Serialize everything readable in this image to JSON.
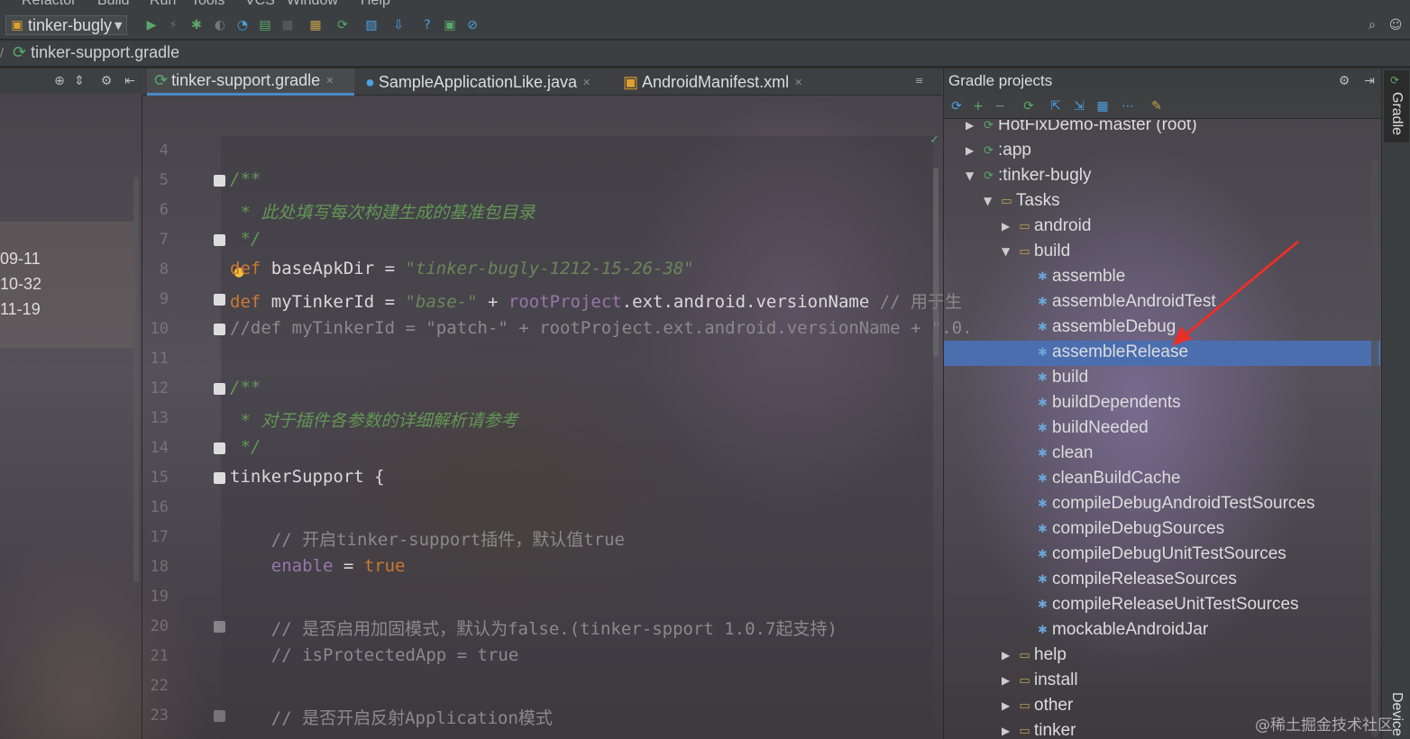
{
  "menu": {
    "items": [
      "Refactor",
      "Build",
      "Run",
      "Tools",
      "VCS",
      "Window",
      "Help"
    ]
  },
  "toolbar": {
    "run_config": "tinker-bugly"
  },
  "breadcrumb": {
    "file": "tinker-support.gradle"
  },
  "left_panel": {
    "items": [
      "09-11",
      "10-32",
      "11-19"
    ]
  },
  "editor": {
    "tabs": [
      {
        "label": "tinker-support.gradle",
        "active": true
      },
      {
        "label": "SampleApplicationLike.java",
        "active": false
      },
      {
        "label": "AndroidManifest.xml",
        "active": false
      }
    ],
    "line_numbers": [
      "4",
      "5",
      "6",
      "7",
      "8",
      "9",
      "10",
      "11",
      "12",
      "13",
      "14",
      "15",
      "16",
      "17",
      "18",
      "19",
      "20",
      "21",
      "22",
      "23"
    ],
    "code": {
      "l5": "/**",
      "l6": " * 此处填写每次构建生成的基准包目录",
      "l7": " */",
      "l8_kw": "def",
      "l8_var": " baseApkDir = ",
      "l8_str": "\"tinker-bugly-1212-15-26-38\"",
      "l9_kw": "def",
      "l9_var": " myTinkerId = ",
      "l9_str": "\"base-\"",
      "l9_plus": " + ",
      "l9_field": "rootProject",
      "l9_rest": ".ext.android.versionName",
      "l9_comment": " // 用于生",
      "l10": "//def myTinkerId = \"patch-\" + rootProject.ext.android.versionName + \".0.",
      "l12": "/**",
      "l13": " * 对于插件各参数的详细解析请参考",
      "l14": " */",
      "l15": "tinkerSupport {",
      "l17": "    // 开启tinker-support插件，默认值true",
      "l18_field": "    enable",
      "l18_eq": " = ",
      "l18_val": "true",
      "l20": "    // 是否启用加固模式，默认为false.(tinker-spport 1.0.7起支持)",
      "l21": "    // isProtectedApp = true",
      "l23": "    // 是否开启反射Application模式"
    }
  },
  "gradle": {
    "title": "Gradle projects",
    "tree": [
      {
        "label": "HotFixDemo-master (root)",
        "indent": 0,
        "icon": "gradle",
        "arrow": "right"
      },
      {
        "label": ":app",
        "indent": 0,
        "icon": "gradle",
        "arrow": "right"
      },
      {
        "label": ":tinker-bugly",
        "indent": 0,
        "icon": "gradle",
        "arrow": "down"
      },
      {
        "label": "Tasks",
        "indent": 1,
        "icon": "folder",
        "arrow": "down"
      },
      {
        "label": "android",
        "indent": 2,
        "icon": "folder",
        "arrow": "right"
      },
      {
        "label": "build",
        "indent": 2,
        "icon": "folder",
        "arrow": "down"
      },
      {
        "label": "assemble",
        "indent": 3,
        "icon": "gear",
        "arrow": ""
      },
      {
        "label": "assembleAndroidTest",
        "indent": 3,
        "icon": "gear",
        "arrow": ""
      },
      {
        "label": "assembleDebug",
        "indent": 3,
        "icon": "gear",
        "arrow": ""
      },
      {
        "label": "assembleRelease",
        "indent": 3,
        "icon": "gear",
        "arrow": "",
        "selected": true
      },
      {
        "label": "build",
        "indent": 3,
        "icon": "gear",
        "arrow": ""
      },
      {
        "label": "buildDependents",
        "indent": 3,
        "icon": "gear",
        "arrow": ""
      },
      {
        "label": "buildNeeded",
        "indent": 3,
        "icon": "gear",
        "arrow": ""
      },
      {
        "label": "clean",
        "indent": 3,
        "icon": "gear",
        "arrow": ""
      },
      {
        "label": "cleanBuildCache",
        "indent": 3,
        "icon": "gear",
        "arrow": ""
      },
      {
        "label": "compileDebugAndroidTestSources",
        "indent": 3,
        "icon": "gear",
        "arrow": ""
      },
      {
        "label": "compileDebugSources",
        "indent": 3,
        "icon": "gear",
        "arrow": ""
      },
      {
        "label": "compileDebugUnitTestSources",
        "indent": 3,
        "icon": "gear",
        "arrow": ""
      },
      {
        "label": "compileReleaseSources",
        "indent": 3,
        "icon": "gear",
        "arrow": ""
      },
      {
        "label": "compileReleaseUnitTestSources",
        "indent": 3,
        "icon": "gear",
        "arrow": ""
      },
      {
        "label": "mockableAndroidJar",
        "indent": 3,
        "icon": "gear",
        "arrow": ""
      },
      {
        "label": "help",
        "indent": 2,
        "icon": "folder",
        "arrow": "right"
      },
      {
        "label": "install",
        "indent": 2,
        "icon": "folder",
        "arrow": "right"
      },
      {
        "label": "other",
        "indent": 2,
        "icon": "folder",
        "arrow": "right"
      },
      {
        "label": "tinker",
        "indent": 2,
        "icon": "folder",
        "arrow": "right"
      }
    ]
  },
  "right_stripe": {
    "gradle_label": "Gradle",
    "device_label": "Device"
  },
  "watermark": "@稀土掘金技术社区",
  "colors": {
    "selection": "#4b6eaf",
    "annotation_arrow": "#e8302a",
    "comment": "#629755",
    "keyword": "#cc7832",
    "string": "#6a8759"
  }
}
